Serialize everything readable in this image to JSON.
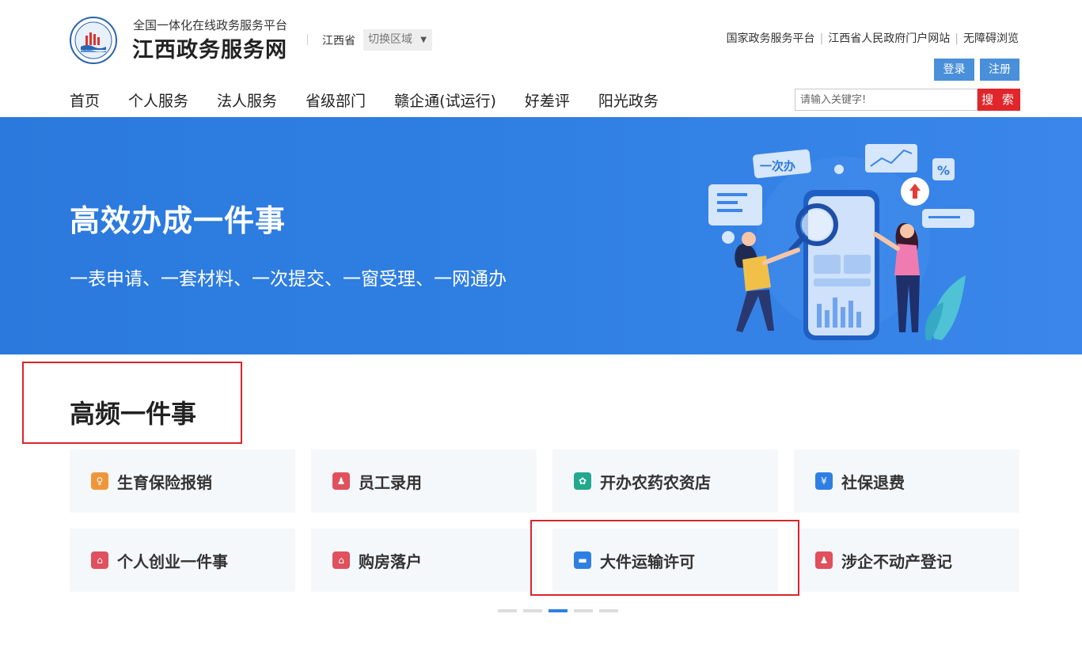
{
  "header": {
    "platform_subtitle": "全国一体化在线政务服务平台",
    "site_title": "江西政务服务网",
    "province": "江西省",
    "region_switch_label": "切换区域",
    "top_links": [
      "国家政务服务平台",
      "江西省人民政府门户网站",
      "无障碍浏览"
    ],
    "login_label": "登录",
    "register_label": "注册"
  },
  "nav": {
    "items": [
      "首页",
      "个人服务",
      "法人服务",
      "省级部门",
      "赣企通(试运行)",
      "好差评",
      "阳光政务"
    ]
  },
  "search": {
    "placeholder": "请输入关键字!",
    "button_label": "搜 索"
  },
  "banner": {
    "title": "高效办成一件事",
    "subtitle": "一表申请、一套材料、一次提交、一窗受理、一网通办",
    "art_tag": "一次办"
  },
  "section": {
    "title": "高频一件事",
    "cards": [
      {
        "label": "生育保险报销",
        "icon": "maternity-icon",
        "color": "#f0963a",
        "glyph": "♀"
      },
      {
        "label": "员工录用",
        "icon": "staff-icon",
        "color": "#e0505d",
        "glyph": "♟"
      },
      {
        "label": "开办农药农资店",
        "icon": "agriculture-icon",
        "color": "#21a98e",
        "glyph": "✿"
      },
      {
        "label": "社保退费",
        "icon": "refund-icon",
        "color": "#2f7fe3",
        "glyph": "¥"
      },
      {
        "label": "个人创业一件事",
        "icon": "business-home-icon",
        "color": "#e0505d",
        "glyph": "⌂"
      },
      {
        "label": "购房落户",
        "icon": "house-icon",
        "color": "#e0505d",
        "glyph": "⌂"
      },
      {
        "label": "大件运输许可",
        "icon": "truck-icon",
        "color": "#2f7fe3",
        "glyph": "▬"
      },
      {
        "label": "涉企不动产登记",
        "icon": "property-icon",
        "color": "#e0505d",
        "glyph": "♟"
      }
    ]
  },
  "pagination": {
    "total": 5,
    "active_index": 2
  },
  "theme": {
    "accent": "#2f7fe3",
    "search_red": "#e0262b",
    "button_blue": "#4a8fd9"
  }
}
